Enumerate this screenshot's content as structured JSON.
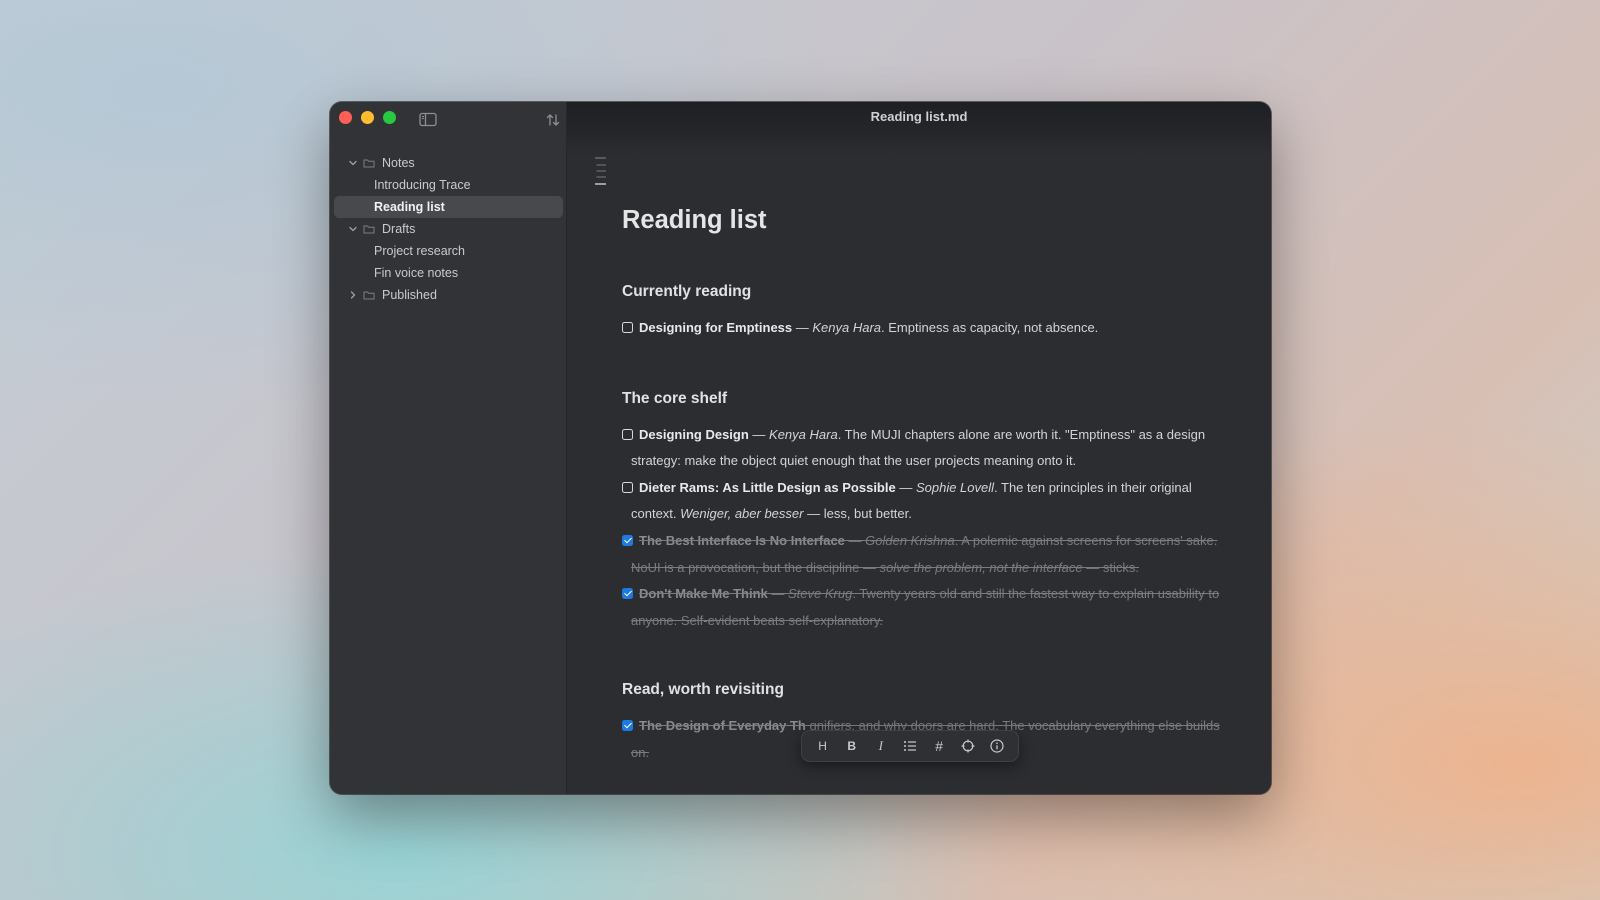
{
  "window": {
    "title": "Reading list.md",
    "traffic_lights": [
      "close",
      "minimize",
      "zoom"
    ]
  },
  "sidebar": {
    "toggle_icon": "sidebar-toggle-icon",
    "sort_icon": "sort-arrows-icon",
    "tree": [
      {
        "type": "folder",
        "label": "Notes",
        "expanded": true
      },
      {
        "type": "file",
        "label": "Introducing Trace",
        "active": false
      },
      {
        "type": "file",
        "label": "Reading list",
        "active": true
      },
      {
        "type": "folder",
        "label": "Drafts",
        "expanded": true
      },
      {
        "type": "file",
        "label": "Project research",
        "active": false
      },
      {
        "type": "file",
        "label": "Fin voice notes",
        "active": false
      },
      {
        "type": "folder",
        "label": "Published",
        "expanded": false
      }
    ]
  },
  "document": {
    "title": "Reading list",
    "sections": [
      {
        "heading": "Currently reading",
        "tasks": [
          {
            "checked": false,
            "title": "Designing for Emptiness",
            "sep": " — ",
            "author": "Kenya Hara",
            "rest": ". Emptiness as capacity, not absence."
          }
        ]
      },
      {
        "heading": "The core shelf",
        "tasks": [
          {
            "checked": false,
            "title": "Designing Design",
            "sep": " — ",
            "author": "Kenya Hara",
            "rest": ". The MUJI chapters alone are worth it. \"Emptiness\" as a design strategy: make the object quiet enough that the user projects meaning onto it."
          },
          {
            "checked": false,
            "title": "Dieter Rams: As Little Design as Possible",
            "sep": " — ",
            "author": "Sophie Lovell",
            "rest": ". The ten principles in their original context. ",
            "italic_extra": "Weniger, aber besser",
            "tail": " — less, but better."
          },
          {
            "checked": true,
            "title": "The Best Interface Is No Interface",
            "sep": " — ",
            "author": "Golden Krishna",
            "rest": ". A polemic against screens for screens' sake. NoUI is a provocation, but the discipline ",
            "italic_extra": "— solve the problem, not the interface —",
            "tail": " sticks."
          },
          {
            "checked": true,
            "title": "Don't Make Me Think",
            "sep": " — ",
            "author": "Steve Krug",
            "rest": ". Twenty years old and still the fastest way to explain usability to anyone. Self-evident beats self-explanatory."
          }
        ]
      },
      {
        "heading": "Read, worth revisiting",
        "tasks": [
          {
            "checked": true,
            "title": "The Design of Everyday Th",
            "sep": "",
            "author": "",
            "rest": "                                                        gnifiers, and why doors are hard. The vocabulary everything else builds on."
          }
        ]
      }
    ]
  },
  "format_toolbar": {
    "heading_label": "H",
    "bold_label": "B",
    "italic_label": "I",
    "list_icon": "bullet-list-icon",
    "tag_label": "#",
    "target_icon": "crosshair-icon",
    "info_icon": "info-icon"
  }
}
